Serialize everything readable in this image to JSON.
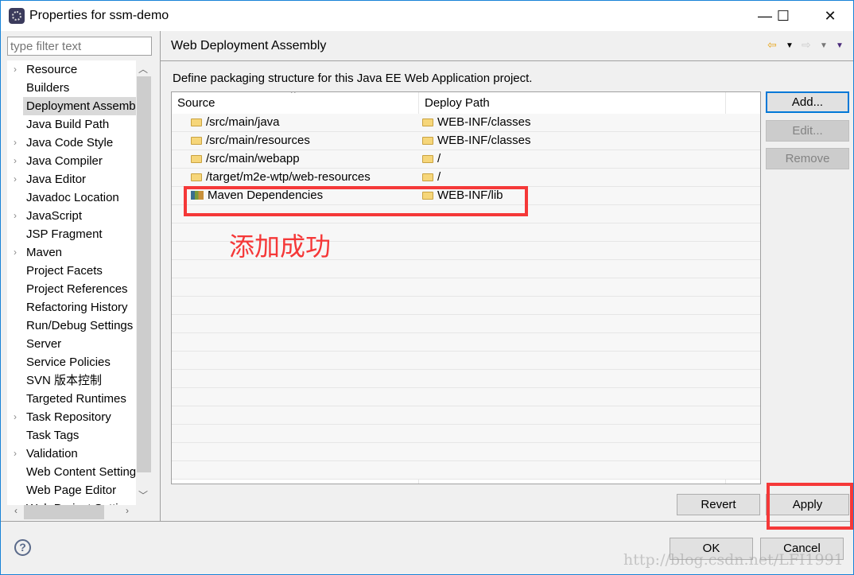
{
  "window": {
    "title": "Properties for ssm-demo",
    "controls": [
      "—",
      "☐",
      "✕"
    ]
  },
  "sidebar": {
    "filter_placeholder": "type filter text",
    "items": [
      {
        "label": "Resource",
        "expandable": true
      },
      {
        "label": "Builders",
        "expandable": false
      },
      {
        "label": "Deployment Assembly",
        "expandable": false,
        "selected": true
      },
      {
        "label": "Java Build Path",
        "expandable": false
      },
      {
        "label": "Java Code Style",
        "expandable": true
      },
      {
        "label": "Java Compiler",
        "expandable": true
      },
      {
        "label": "Java Editor",
        "expandable": true
      },
      {
        "label": "Javadoc Location",
        "expandable": false
      },
      {
        "label": "JavaScript",
        "expandable": true
      },
      {
        "label": "JSP Fragment",
        "expandable": false
      },
      {
        "label": "Maven",
        "expandable": true
      },
      {
        "label": "Project Facets",
        "expandable": false
      },
      {
        "label": "Project References",
        "expandable": false
      },
      {
        "label": "Refactoring History",
        "expandable": false
      },
      {
        "label": "Run/Debug Settings",
        "expandable": false
      },
      {
        "label": "Server",
        "expandable": false
      },
      {
        "label": "Service Policies",
        "expandable": false
      },
      {
        "label": "SVN 版本控制",
        "expandable": false
      },
      {
        "label": "Targeted Runtimes",
        "expandable": false
      },
      {
        "label": "Task Repository",
        "expandable": true
      },
      {
        "label": "Task Tags",
        "expandable": false
      },
      {
        "label": "Validation",
        "expandable": true
      },
      {
        "label": "Web Content Settings",
        "expandable": false
      },
      {
        "label": "Web Page Editor",
        "expandable": false
      },
      {
        "label": "Web Project Settings",
        "expandable": false
      }
    ]
  },
  "page": {
    "title": "Web Deployment Assembly",
    "description": "Define packaging structure for this Java EE Web Application project.",
    "nav": {
      "back": "⇦",
      "forward": "⇨",
      "menu": "▼"
    },
    "table": {
      "columns": [
        "Source",
        "Deploy Path"
      ],
      "rows": [
        {
          "source": "/src/main/java",
          "deploy": "WEB-INF/classes",
          "icon": "folder"
        },
        {
          "source": "/src/main/resources",
          "deploy": "WEB-INF/classes",
          "icon": "folder"
        },
        {
          "source": "/src/main/webapp",
          "deploy": "/",
          "icon": "folder"
        },
        {
          "source": "/target/m2e-wtp/web-resources",
          "deploy": "/",
          "icon": "folder"
        },
        {
          "source": "Maven Dependencies",
          "deploy": "WEB-INF/lib",
          "icon": "library"
        }
      ]
    },
    "buttons": {
      "add": "Add...",
      "edit": "Edit...",
      "remove": "Remove",
      "revert": "Revert",
      "apply": "Apply"
    }
  },
  "annotation": {
    "text": "添加成功",
    "color": "#f53838"
  },
  "footer": {
    "ok": "OK",
    "cancel": "Cancel",
    "help": "?"
  },
  "watermark": "http://blog.csdn.net/LFI1991"
}
